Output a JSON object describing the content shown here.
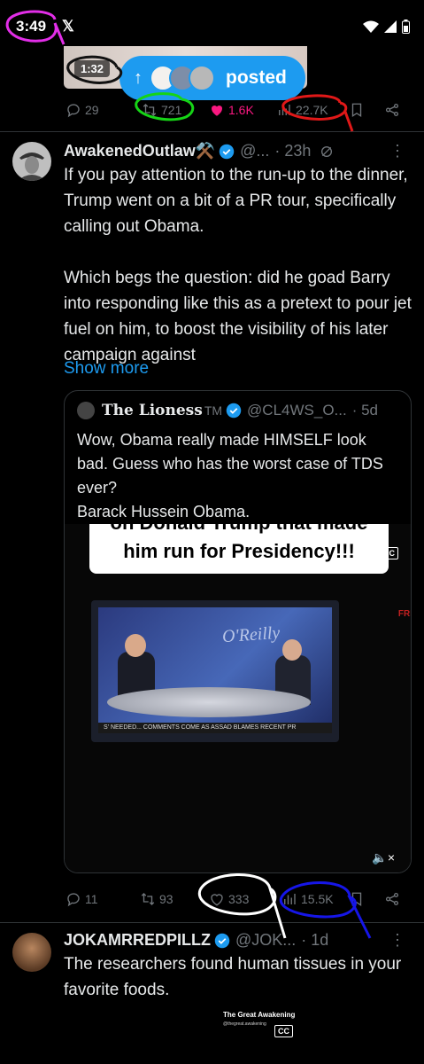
{
  "status_bar": {
    "time": "3:49",
    "app_icon": "x-logo-icon"
  },
  "top_post": {
    "video_time": "1:32",
    "posted_pill_label": "posted",
    "stats": {
      "replies": "29",
      "reposts": "721",
      "likes": "1.6K",
      "views": "22.7K"
    }
  },
  "tweet": {
    "display_name": "AwakenedOutlaw⚒️",
    "handle": "@...",
    "time": "· 23h",
    "text": "If you pay attention to the run-up to the dinner, Trump went on a bit of a PR tour, specifically calling out Obama.\n\nWhich begs the question: did he goad Barry into responding like this as a pretext to pour jet fuel on him, to boost the visibility of his later campaign against",
    "show_more": "Show more",
    "quote": {
      "display_name": "The Lioness",
      "tm": "TM",
      "handle": "@CL4WS_O...",
      "time": "· 5d",
      "text": "Wow, Obama really made HIMSELF look bad. Guess who has the worst case of TDS ever?\nBarack Hussein Obama.",
      "caption_line1": "on Donald Trump that made",
      "caption_line2": "him run for Presidency!!!",
      "cc": "CC",
      "tv_logo": "O'Reilly",
      "ticker": "S' NEEDED... COMMENTS COME AS ASSAD BLAMES RECENT PR",
      "corner_tag": "FRI"
    },
    "stats": {
      "replies": "11",
      "reposts": "93",
      "likes": "333",
      "views": "15.5K"
    }
  },
  "next_tweet": {
    "display_name": "JOKAMRREDPILLZ",
    "handle": "@JOK...",
    "time": "· 1d",
    "text": "The researchers found human tissues in your favorite foods.",
    "video_title": "The Great Awakening",
    "video_sub": "@thegreat.awakening",
    "cc": "CC"
  }
}
